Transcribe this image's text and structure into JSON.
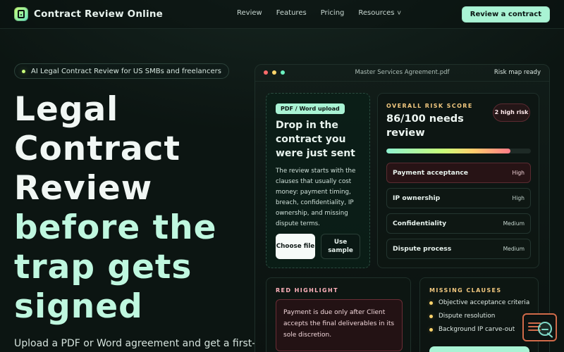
{
  "nav": {
    "brand": "Contract Review Online",
    "links": [
      "Review",
      "Features",
      "Pricing",
      "Resources"
    ],
    "resources_chevron": "v",
    "cta": "Review a contract"
  },
  "hero": {
    "pill": "AI Legal Contract Review for US SMBs and freelancers",
    "title_white": [
      "Legal",
      "Contract",
      "Review"
    ],
    "title_mint": [
      "before the",
      "trap gets",
      "signed"
    ],
    "subtitle": "Upload a PDF or Word agreement and get a first-"
  },
  "preview": {
    "filename": "Master Services Agreement.pdf",
    "status": "Risk map ready",
    "upload": {
      "badge": "PDF / Word upload",
      "title": "Drop in the contract you were just sent",
      "body": "The review starts with the clauses that usually cost money: payment timing, breach, confidentiality, IP ownership, and missing dispute terms.",
      "choose_file": "Choose file",
      "use_sample": "Use sample"
    },
    "risk": {
      "label": "OVERALL RISK SCORE",
      "score_text": "86/100 needs review",
      "score_value": 86,
      "pill": "2 high risk",
      "clauses": [
        {
          "name": "Payment acceptance",
          "level": "High"
        },
        {
          "name": "IP ownership",
          "level": "High"
        },
        {
          "name": "Confidentiality",
          "level": "Medium"
        },
        {
          "name": "Dispute process",
          "level": "Medium"
        }
      ]
    },
    "red_highlight": {
      "label": "RED HIGHLIGHT",
      "text": "Payment is due only after Client accepts the final deliverables in its sole discretion."
    },
    "missing_clauses": {
      "label": "MISSING CLAUSES",
      "items": [
        "Objective acceptance criteria",
        "Dispute resolution",
        "Background IP carve-out"
      ]
    }
  },
  "colors": {
    "mint": "#bff7df",
    "cta": "#a9f3d4",
    "amber": "#f2c87f",
    "red": "#e86f7e"
  },
  "icons": {
    "brand": "document-icon",
    "window_dots": [
      "close-dot",
      "minimize-dot",
      "zoom-dot"
    ],
    "floating_widget": "search-icon"
  }
}
